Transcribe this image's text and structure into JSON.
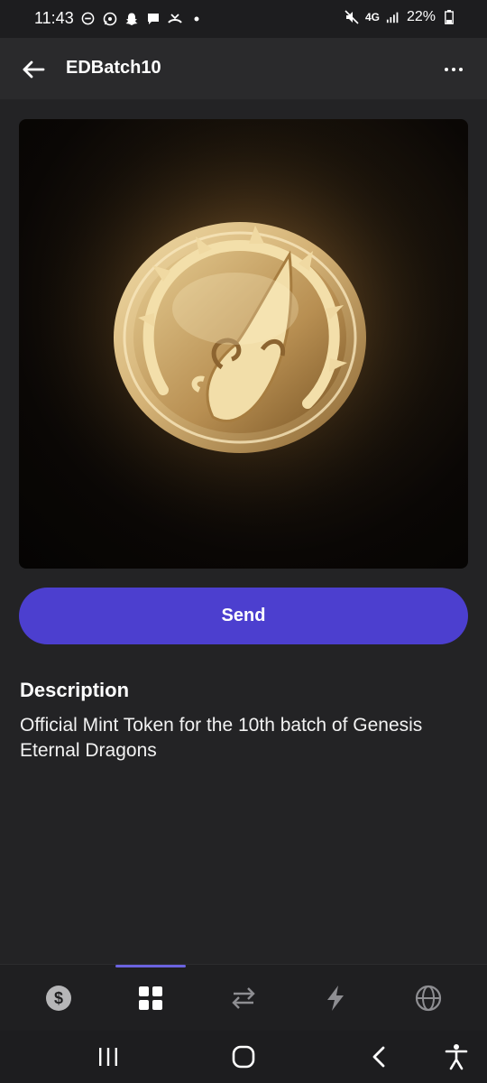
{
  "status_bar": {
    "time": "11:43",
    "network": "4G",
    "battery": "22%",
    "left_icons": [
      "do-not-disturb-icon",
      "whatsapp-icon",
      "snapchat-icon",
      "message-icon",
      "missed-call-icon",
      "dot-icon"
    ],
    "right_icons": [
      "mute-icon",
      "network-icon",
      "signal-icon",
      "battery-icon"
    ]
  },
  "header": {
    "title": "EDBatch10",
    "back_icon": "arrow-left-icon",
    "menu_icon": "more-horizontal-icon"
  },
  "nft": {
    "image_icon": "dragon-coin-image"
  },
  "actions": {
    "send_label": "Send"
  },
  "description": {
    "heading": "Description",
    "text": "Official Mint Token for the 10th batch of Genesis Eternal Dragons"
  },
  "tabs": [
    {
      "icon": "dollar-icon",
      "active": false
    },
    {
      "icon": "grid-icon",
      "active": true
    },
    {
      "icon": "swap-arrows-icon",
      "active": false
    },
    {
      "icon": "lightning-icon",
      "active": false
    },
    {
      "icon": "globe-icon",
      "active": false
    }
  ],
  "android_nav": [
    "recents-icon",
    "home-icon",
    "back-icon",
    "accessibility-icon"
  ],
  "colors": {
    "background": "#232325",
    "header": "#2a2a2c",
    "accent": "#4c3fcf",
    "tab_indicator": "#6b63e0"
  }
}
